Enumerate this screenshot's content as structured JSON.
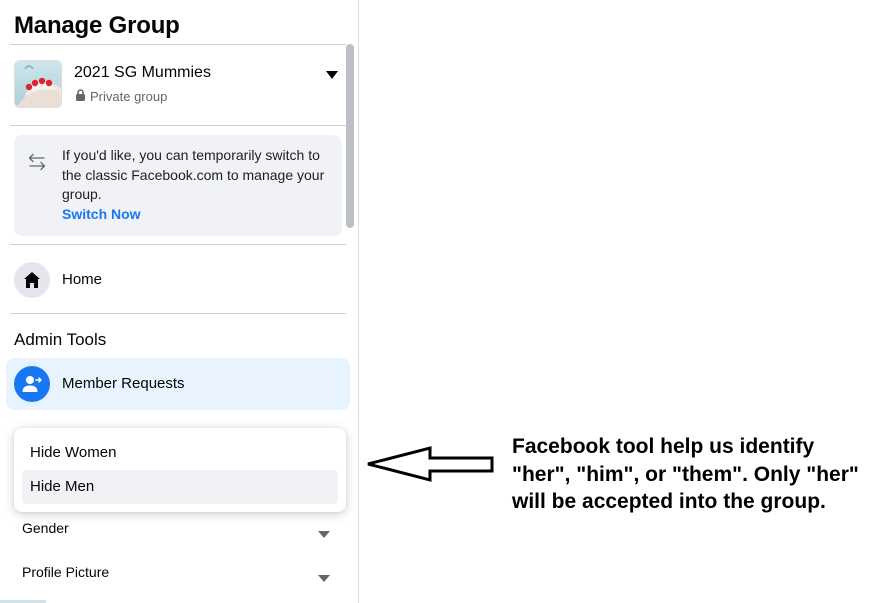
{
  "panel": {
    "title": "Manage Group",
    "group": {
      "name": "2021 SG Mummies",
      "privacy": "Private group",
      "privacy_icon": "lock-icon",
      "menu_icon": "caret-down-icon"
    },
    "notice": {
      "icon": "switch-arrows-icon",
      "text": "If you'd like, you can temporarily switch to the classic Facebook.com to manage your group.",
      "link": "Switch Now"
    },
    "nav": {
      "home": {
        "label": "Home",
        "icon": "home-icon"
      }
    },
    "admin_tools": {
      "heading": "Admin Tools",
      "member_requests": {
        "label": "Member Requests",
        "icon": "member-requests-icon",
        "selected": true
      }
    },
    "dropdown": {
      "options": [
        {
          "label": "Hide Women",
          "highlighted": false
        },
        {
          "label": "Hide Men",
          "highlighted": true
        }
      ]
    },
    "filters": [
      {
        "label": "Gender",
        "icon": "caret-down-icon"
      },
      {
        "label": "Profile Picture",
        "icon": "caret-down-icon"
      }
    ]
  },
  "annotation": {
    "text": "Facebook tool help us identify \"her\", \"him\", or \"them\". Only \"her\" will be accepted into the group.",
    "arrow_icon": "left-arrow-icon"
  },
  "colors": {
    "accent": "#1877f2",
    "selected_bg": "#e7f3ff",
    "notice_bg": "#f0f2f5",
    "hover_bg": "#f0f2f5",
    "divider": "#ced0d4",
    "secondary_text": "#65676b"
  }
}
